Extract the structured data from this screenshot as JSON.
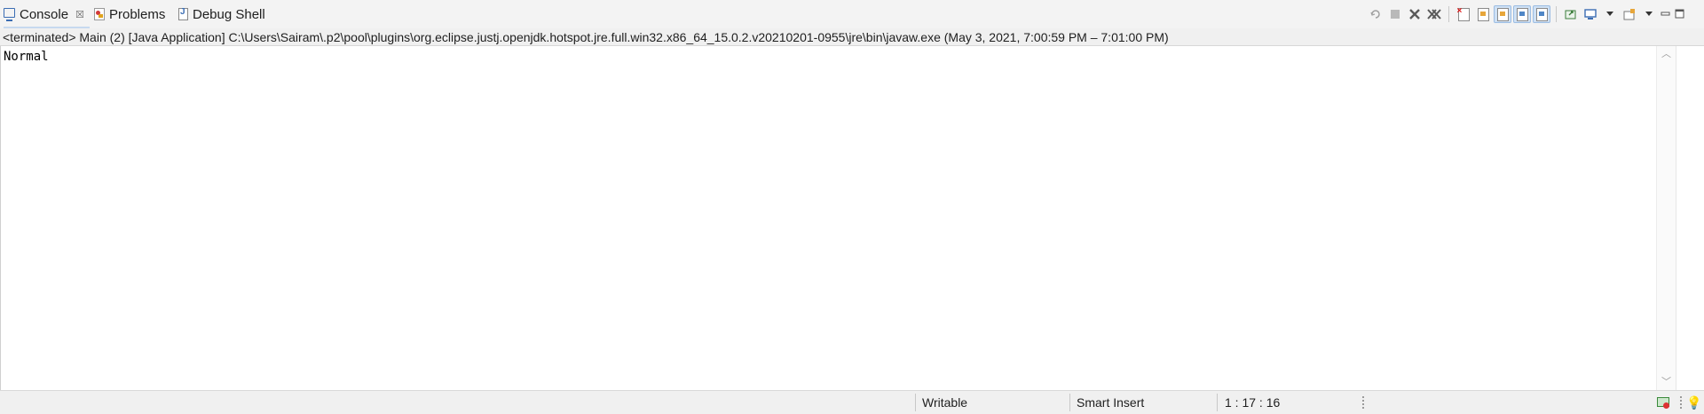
{
  "tabs": [
    {
      "label": "Console",
      "icon": "console-icon",
      "active": true,
      "close": "☒"
    },
    {
      "label": "Problems",
      "icon": "problems-icon",
      "active": false
    },
    {
      "label": "Debug Shell",
      "icon": "debug-shell-icon",
      "active": false
    }
  ],
  "toolbar": {
    "icons": [
      "pin-icon",
      "terminate-icon",
      "remove-launch-icon",
      "remove-all-terminated-icon",
      "clear-console-icon",
      "scroll-lock-icon",
      "word-wrap-icon",
      "show-on-stdout-icon",
      "show-on-stderr-icon",
      "pin-console-icon",
      "display-selected-console-icon",
      "open-console-icon",
      "minimize-icon",
      "maximize-icon"
    ]
  },
  "path_line": "<terminated> Main (2) [Java Application] C:\\Users\\Sairam\\.p2\\pool\\plugins\\org.eclipse.justj.openjdk.hotspot.jre.full.win32.x86_64_15.0.2.v20210201-0955\\jre\\bin\\javaw.exe  (May 3, 2021, 7:00:59 PM – 7:01:00 PM)",
  "console": {
    "output": "Normal"
  },
  "status": {
    "writable": "Writable",
    "insert_mode": "Smart Insert",
    "cursor_position": "1 : 17 : 16"
  },
  "colors": {
    "accent": "#3b6db3",
    "pressed_bg": "#cfe1f5"
  }
}
